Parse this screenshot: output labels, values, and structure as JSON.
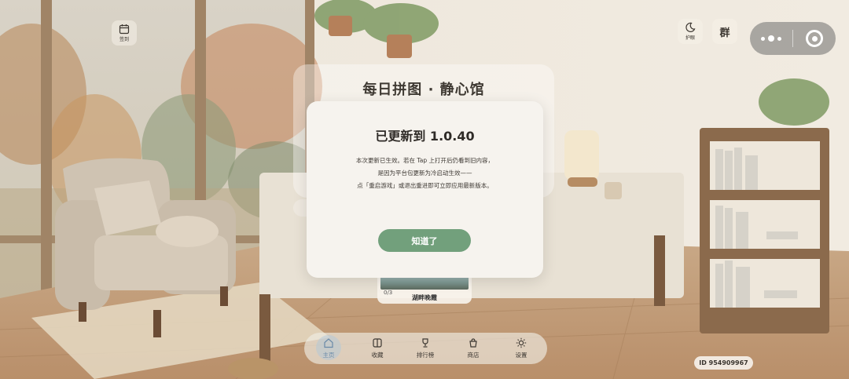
{
  "header": {
    "title": "每日拼图 · 静心馆",
    "checkin_label": "签到",
    "eyecare_label": "护眼",
    "group_label": "群"
  },
  "dialog": {
    "title": "已更新到 1.0.40",
    "body": [
      "本次更新已生效。若在 Tap 上打开后仍看到旧内容，",
      "是因为平台包更新为冷启动生效——",
      "点「重启游戏」或退出重进即可立即应用最新版本。"
    ],
    "ok_label": "知道了"
  },
  "puzzle": {
    "progress": "0/3",
    "name": "湖畔晚霞"
  },
  "nav": {
    "items": [
      {
        "label": "主页",
        "icon": "home-icon",
        "active": true
      },
      {
        "label": "收藏",
        "icon": "book-icon",
        "active": false
      },
      {
        "label": "排行榜",
        "icon": "trophy-icon",
        "active": false
      },
      {
        "label": "商店",
        "icon": "shop-icon",
        "active": false
      },
      {
        "label": "设置",
        "icon": "sun-icon",
        "active": false
      }
    ]
  },
  "user": {
    "id_text": "ID 954909967"
  },
  "colors": {
    "accent_green": "#72a07c",
    "dialog_bg": "#f6f3ee",
    "nav_active": "#6a8aa8"
  }
}
